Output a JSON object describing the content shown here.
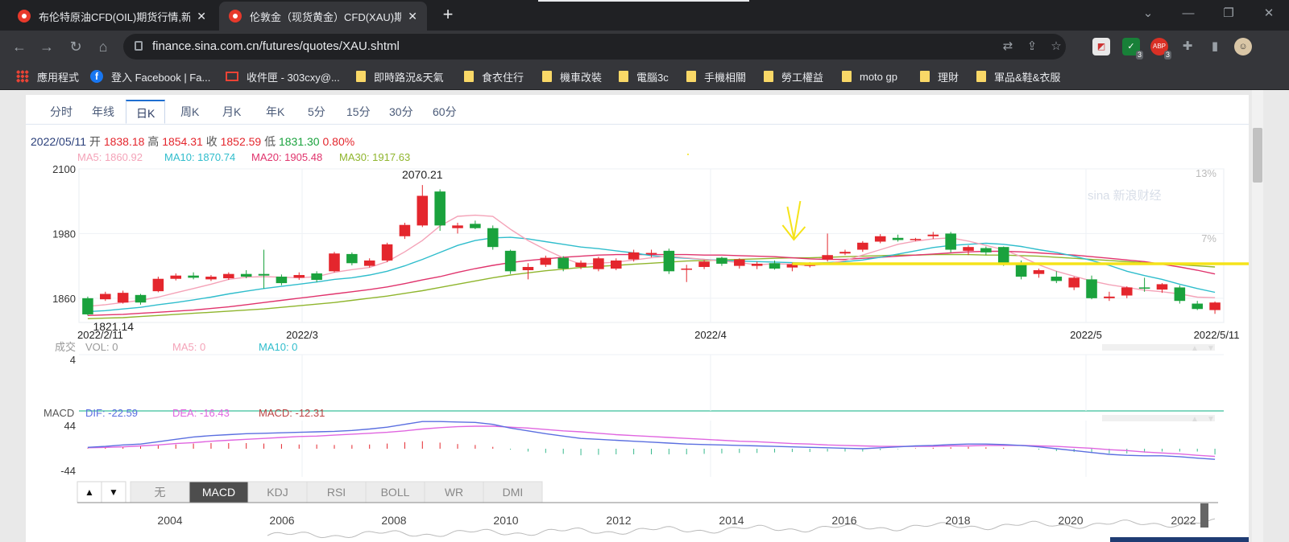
{
  "browser": {
    "tabs": [
      {
        "title": "布伦特原油CFD(OIL)期货行情,新",
        "active": false
      },
      {
        "title": "伦敦金（现货黄金）CFD(XAU)期",
        "active": true
      }
    ],
    "url": "finance.sina.com.cn/futures/quotes/XAU.shtml",
    "extensions": [
      {
        "name": "translate-icon"
      },
      {
        "name": "share-icon"
      },
      {
        "name": "star-icon"
      }
    ],
    "ext_badges": [
      "3",
      "3"
    ],
    "ext_abp": "ABP"
  },
  "bookmarks": [
    {
      "label": "應用程式",
      "icon": "apps-icon"
    },
    {
      "label": "登入 Facebook | Fa...",
      "icon": "facebook-icon"
    },
    {
      "label": "收件匣 - 303cxy@...",
      "icon": "gmail-icon"
    },
    {
      "label": "即時路況&天氣",
      "icon": "folder-icon"
    },
    {
      "label": "食衣住行",
      "icon": "folder-icon"
    },
    {
      "label": "機車改裝",
      "icon": "folder-icon"
    },
    {
      "label": "電腦3c",
      "icon": "folder-icon"
    },
    {
      "label": "手機相關",
      "icon": "folder-icon"
    },
    {
      "label": "勞工權益",
      "icon": "folder-icon"
    },
    {
      "label": "moto gp",
      "icon": "folder-icon"
    },
    {
      "label": "理財",
      "icon": "folder-icon"
    },
    {
      "label": "軍品&鞋&衣服",
      "icon": "folder-icon"
    }
  ],
  "period_tabs": [
    "分时",
    "年线",
    "日K",
    "周K",
    "月K",
    "年K",
    "5分",
    "15分",
    "30分",
    "60分"
  ],
  "active_period": "日K",
  "quote": {
    "date": "2022/05/11",
    "open_label": "开",
    "open": "1838.18",
    "high_label": "高",
    "high": "1854.31",
    "close_label": "收",
    "close": "1852.59",
    "low_label": "低",
    "low": "1831.30",
    "change": "0.80%"
  },
  "ma_legend": {
    "ma5": "MA5: 1860.92",
    "ma10": "MA10: 1870.74",
    "ma20": "MA20: 1905.48",
    "ma30": "MA30: 1917.63"
  },
  "volume_legend": {
    "label": "成交",
    "vol": "VOL: 0",
    "ma5": "MA5: 0",
    "ma10": "MA10: 0",
    "axis_max": "4"
  },
  "macd_legend": {
    "label": "MACD",
    "dif": "DIF: -22.59",
    "dea": "DEA: -16.43",
    "macd": "MACD: -12.31",
    "axis_top": "44",
    "axis_bottom": "-44"
  },
  "indicator_tabs": [
    "无",
    "MACD",
    "KDJ",
    "RSI",
    "BOLL",
    "WR",
    "DMI"
  ],
  "active_indicator": "MACD",
  "up_arrow": "▲",
  "down_arrow": "▼",
  "overview_years": [
    "2004",
    "2006",
    "2008",
    "2010",
    "2012",
    "2014",
    "2016",
    "2018",
    "2020",
    "2022"
  ],
  "watermark": "sina 新浪财经",
  "colors": {
    "up": "#e4262d",
    "down": "#1aa23d",
    "ma5": "#f4a3b8",
    "ma10": "#2fbdcc",
    "ma20": "#e0336c",
    "ma30": "#8fb52d",
    "dif": "#5b6fe0",
    "dea": "#e066e0",
    "annotation": "#f5e31a"
  },
  "chart_data": {
    "type": "candlestick",
    "ylim": [
      1815,
      2100
    ],
    "yticks": [
      2100,
      1980,
      1860
    ],
    "right_pct_ticks": [
      "13%",
      "7%"
    ],
    "x_labels": [
      "2022/2/11",
      "2022/3",
      "2022/4",
      "2022/5",
      "2022/5/11"
    ],
    "max_label": "2070.21",
    "min_label": "1821.14",
    "candles": [
      [
        1860,
        1830,
        1863,
        1828
      ],
      [
        1858,
        1868,
        1872,
        1855
      ],
      [
        1852,
        1870,
        1874,
        1850
      ],
      [
        1866,
        1852,
        1868,
        1848
      ],
      [
        1873,
        1896,
        1900,
        1871
      ],
      [
        1896,
        1902,
        1906,
        1893
      ],
      [
        1902,
        1898,
        1908,
        1895
      ],
      [
        1895,
        1900,
        1903,
        1892
      ],
      [
        1897,
        1905,
        1908,
        1894
      ],
      [
        1905,
        1900,
        1912,
        1897
      ],
      [
        1905,
        1902,
        1950,
        1878
      ],
      [
        1900,
        1888,
        1904,
        1884
      ],
      [
        1898,
        1903,
        1908,
        1894
      ],
      [
        1906,
        1894,
        1910,
        1890
      ],
      [
        1910,
        1943,
        1946,
        1908
      ],
      [
        1942,
        1925,
        1945,
        1921
      ],
      [
        1920,
        1930,
        1934,
        1917
      ],
      [
        1930,
        1960,
        1963,
        1927
      ],
      [
        1975,
        1996,
        2000,
        1970
      ],
      [
        1995,
        2050,
        2070,
        1992
      ],
      [
        2058,
        1995,
        2062,
        1985
      ],
      [
        1990,
        1995,
        2000,
        1980
      ],
      [
        1998,
        1990,
        2004,
        1988
      ],
      [
        1990,
        1955,
        1995,
        1950
      ],
      [
        1948,
        1910,
        1950,
        1905
      ],
      [
        1912,
        1918,
        1925,
        1895
      ],
      [
        1922,
        1935,
        1939,
        1918
      ],
      [
        1935,
        1915,
        1938,
        1910
      ],
      [
        1918,
        1926,
        1930,
        1914
      ],
      [
        1914,
        1934,
        1937,
        1910
      ],
      [
        1915,
        1930,
        1934,
        1912
      ],
      [
        1932,
        1945,
        1950,
        1928
      ],
      [
        1942,
        1944,
        1950,
        1936
      ],
      [
        1948,
        1910,
        1952,
        1905
      ],
      [
        1915,
        1915,
        1922,
        1890
      ],
      [
        1918,
        1928,
        1931,
        1914
      ],
      [
        1935,
        1924,
        1937,
        1920
      ],
      [
        1920,
        1932,
        1934,
        1915
      ],
      [
        1920,
        1924,
        1928,
        1914
      ],
      [
        1925,
        1915,
        1930,
        1913
      ],
      [
        1917,
        1923,
        1926,
        1910
      ],
      [
        1920,
        1925,
        1927,
        1917
      ],
      [
        1932,
        1940,
        1980,
        1928
      ],
      [
        1943,
        1946,
        1950,
        1940
      ],
      [
        1950,
        1963,
        1966,
        1946
      ],
      [
        1965,
        1975,
        1979,
        1962
      ],
      [
        1972,
        1968,
        1978,
        1965
      ],
      [
        1968,
        1970,
        1972,
        1966
      ],
      [
        1975,
        1978,
        1983,
        1970
      ],
      [
        1980,
        1950,
        1983,
        1945
      ],
      [
        1948,
        1955,
        1958,
        1940
      ],
      [
        1953,
        1945,
        1956,
        1940
      ],
      [
        1955,
        1925,
        1956,
        1920
      ],
      [
        1922,
        1900,
        1930,
        1895
      ],
      [
        1905,
        1912,
        1915,
        1898
      ],
      [
        1900,
        1892,
        1910,
        1888
      ],
      [
        1880,
        1898,
        1900,
        1875
      ],
      [
        1895,
        1860,
        1902,
        1858
      ],
      [
        1860,
        1863,
        1872,
        1855
      ],
      [
        1865,
        1880,
        1882,
        1860
      ],
      [
        1880,
        1878,
        1898,
        1872
      ],
      [
        1876,
        1886,
        1888,
        1870
      ],
      [
        1880,
        1855,
        1884,
        1850
      ],
      [
        1850,
        1840,
        1855,
        1838
      ],
      [
        1838,
        1852,
        1854,
        1831
      ]
    ],
    "ma5": [
      1845,
      1848,
      1852,
      1856,
      1862,
      1870,
      1878,
      1886,
      1895,
      1899,
      1900,
      1899,
      1898,
      1900,
      1908,
      1913,
      1917,
      1928,
      1946,
      1967,
      1994,
      2012,
      2014,
      2012,
      1988,
      1967,
      1950,
      1935,
      1923,
      1925,
      1927,
      1931,
      1935,
      1938,
      1935,
      1932,
      1929,
      1926,
      1922,
      1924,
      1923,
      1920,
      1924,
      1930,
      1940,
      1950,
      1960,
      1966,
      1970,
      1972,
      1966,
      1958,
      1950,
      1937,
      1922,
      1910,
      1901,
      1892,
      1885,
      1880,
      1875,
      1872,
      1868,
      1862,
      1861
    ],
    "ma10": [
      1835,
      1837,
      1840,
      1843,
      1848,
      1852,
      1857,
      1862,
      1868,
      1873,
      1878,
      1882,
      1886,
      1890,
      1895,
      1898,
      1903,
      1910,
      1920,
      1932,
      1945,
      1958,
      1967,
      1972,
      1973,
      1970,
      1965,
      1960,
      1955,
      1952,
      1948,
      1944,
      1939,
      1936,
      1934,
      1932,
      1930,
      1929,
      1928,
      1927,
      1926,
      1925,
      1926,
      1928,
      1931,
      1936,
      1942,
      1948,
      1954,
      1958,
      1960,
      1962,
      1960,
      1956,
      1950,
      1945,
      1938,
      1930,
      1921,
      1910,
      1902,
      1895,
      1886,
      1878,
      1871
    ],
    "ma20": [
      1828,
      1829,
      1830,
      1832,
      1834,
      1836,
      1838,
      1841,
      1844,
      1848,
      1852,
      1856,
      1860,
      1864,
      1868,
      1872,
      1876,
      1881,
      1887,
      1894,
      1900,
      1908,
      1915,
      1921,
      1926,
      1930,
      1933,
      1936,
      1938,
      1940,
      1941,
      1941,
      1941,
      1941,
      1941,
      1940,
      1940,
      1939,
      1938,
      1937,
      1935,
      1933,
      1932,
      1932,
      1934,
      1936,
      1938,
      1940,
      1942,
      1944,
      1946,
      1947,
      1947,
      1946,
      1944,
      1942,
      1940,
      1937,
      1934,
      1931,
      1928,
      1923,
      1918,
      1912,
      1905
    ],
    "ma30": [
      1822,
      1823,
      1824,
      1826,
      1828,
      1830,
      1832,
      1834,
      1836,
      1838,
      1840,
      1843,
      1846,
      1849,
      1852,
      1856,
      1860,
      1864,
      1869,
      1874,
      1880,
      1886,
      1892,
      1898,
      1903,
      1907,
      1911,
      1914,
      1917,
      1919,
      1921,
      1923,
      1925,
      1927,
      1929,
      1930,
      1931,
      1932,
      1933,
      1934,
      1935,
      1935,
      1936,
      1937,
      1938,
      1939,
      1940,
      1940,
      1941,
      1941,
      1941,
      1940,
      1940,
      1939,
      1938,
      1936,
      1934,
      1932,
      1930,
      1928,
      1926,
      1924,
      1922,
      1920,
      1918
    ],
    "macd_dif": [
      3,
      5,
      8,
      10,
      15,
      20,
      25,
      28,
      30,
      32,
      33,
      34,
      35,
      36,
      37,
      39,
      42,
      46,
      52,
      58,
      58,
      57,
      56,
      52,
      44,
      38,
      32,
      27,
      22,
      20,
      18,
      16,
      14,
      12,
      10,
      9,
      8,
      7,
      6,
      5,
      4,
      3,
      2,
      1,
      0,
      2,
      4,
      6,
      7,
      9,
      10,
      10,
      9,
      7,
      4,
      0,
      -4,
      -8,
      -12,
      -14,
      -15,
      -15,
      -17,
      -20,
      -22.59
    ],
    "macd_dea": [
      2,
      3,
      4,
      6,
      8,
      11,
      13,
      16,
      18,
      20,
      22,
      24,
      26,
      27,
      29,
      31,
      33,
      35,
      38,
      42,
      45,
      47,
      48,
      48,
      46,
      44,
      41,
      38,
      36,
      33,
      30,
      28,
      26,
      24,
      22,
      20,
      18,
      16,
      15,
      13,
      11,
      10,
      8,
      7,
      6,
      5,
      5,
      5,
      5,
      6,
      6,
      7,
      7,
      7,
      6,
      5,
      3,
      1,
      -2,
      -4,
      -7,
      -9,
      -11,
      -14,
      -16.43
    ],
    "macd_hist": [
      1,
      2,
      4,
      5,
      7,
      9,
      11,
      12,
      12,
      12,
      11,
      10,
      9,
      9,
      8,
      8,
      9,
      11,
      14,
      16,
      13,
      10,
      8,
      4,
      -2,
      -6,
      -9,
      -11,
      -14,
      -13,
      -12,
      -12,
      -12,
      -12,
      -12,
      -11,
      -10,
      -9,
      -9,
      -8,
      -7,
      -7,
      -6,
      -6,
      -6,
      -3,
      -1,
      1,
      2,
      3,
      4,
      3,
      2,
      0,
      -2,
      -5,
      -7,
      -9,
      -10,
      -10,
      -8,
      -6,
      -6,
      -6,
      -12.31
    ],
    "annotation_level": 1924
  }
}
